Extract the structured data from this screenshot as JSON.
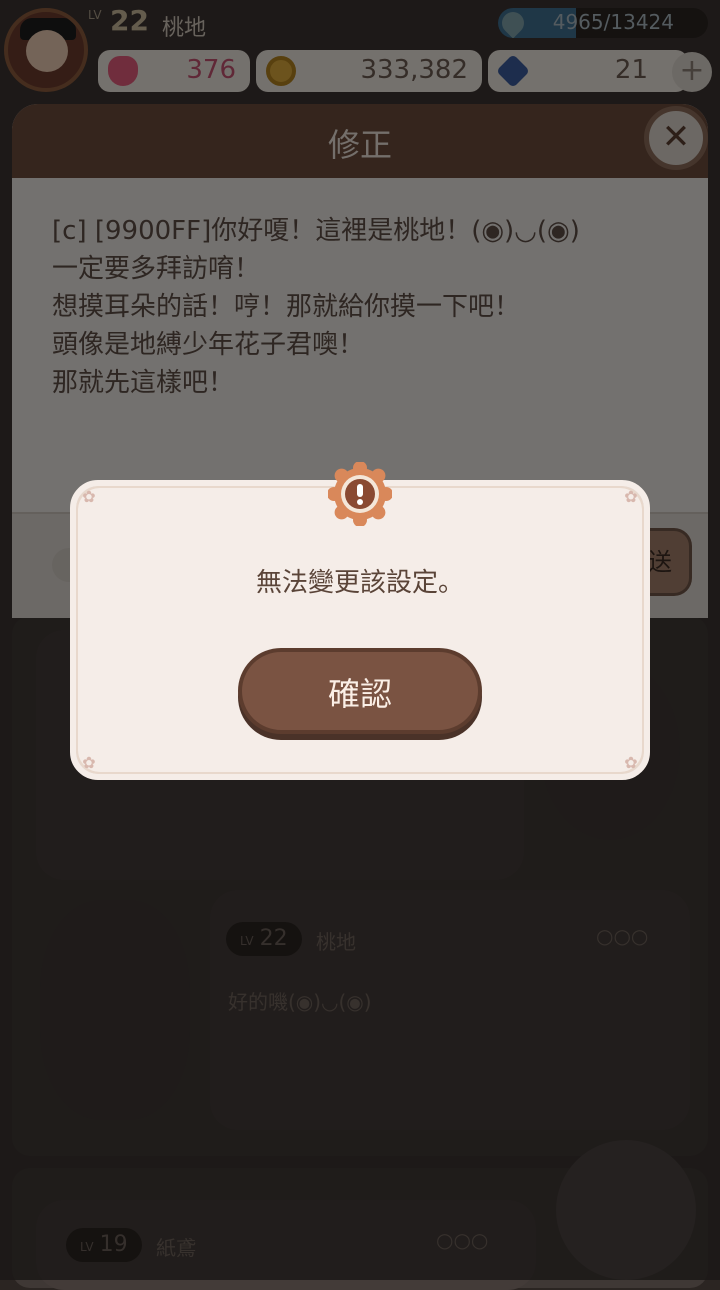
{
  "header": {
    "level_prefix": "LV",
    "level": "22",
    "username": "桃地",
    "exp_text": "4965/13424",
    "exp_fraction": 0.37,
    "hearts": "376",
    "coins": "333,382",
    "gems": "21",
    "plus_label": "+"
  },
  "edit_panel": {
    "title": "修正",
    "close_label": "✕",
    "message": "[c] [9900FF]你好嗄！這裡是桃地！(◉)◡(◉)\n一定要多拜訪唷！\n想摸耳朵的話！哼！那就給你摸一下吧！\n頭像是地縛少年花子君噢！\n那就先這樣吧！",
    "send_label": "送"
  },
  "feed": {
    "post1": {
      "level_prefix": "LV",
      "level": "22",
      "username": "桃地",
      "text": "好的嘰(◉)◡(◉)"
    },
    "post2": {
      "level_prefix": "LV",
      "level": "19",
      "username": "紙鳶"
    }
  },
  "dialog": {
    "message": "無法變更該設定。",
    "confirm_label": "確認",
    "badge_icon": "exclamation-icon"
  },
  "colors": {
    "brown_dark": "#6a4a3a",
    "confirm": "#7a5342",
    "panel_bg": "#e7e2de",
    "dialog_bg": "#f5ede8",
    "badge": "#d9885a"
  }
}
